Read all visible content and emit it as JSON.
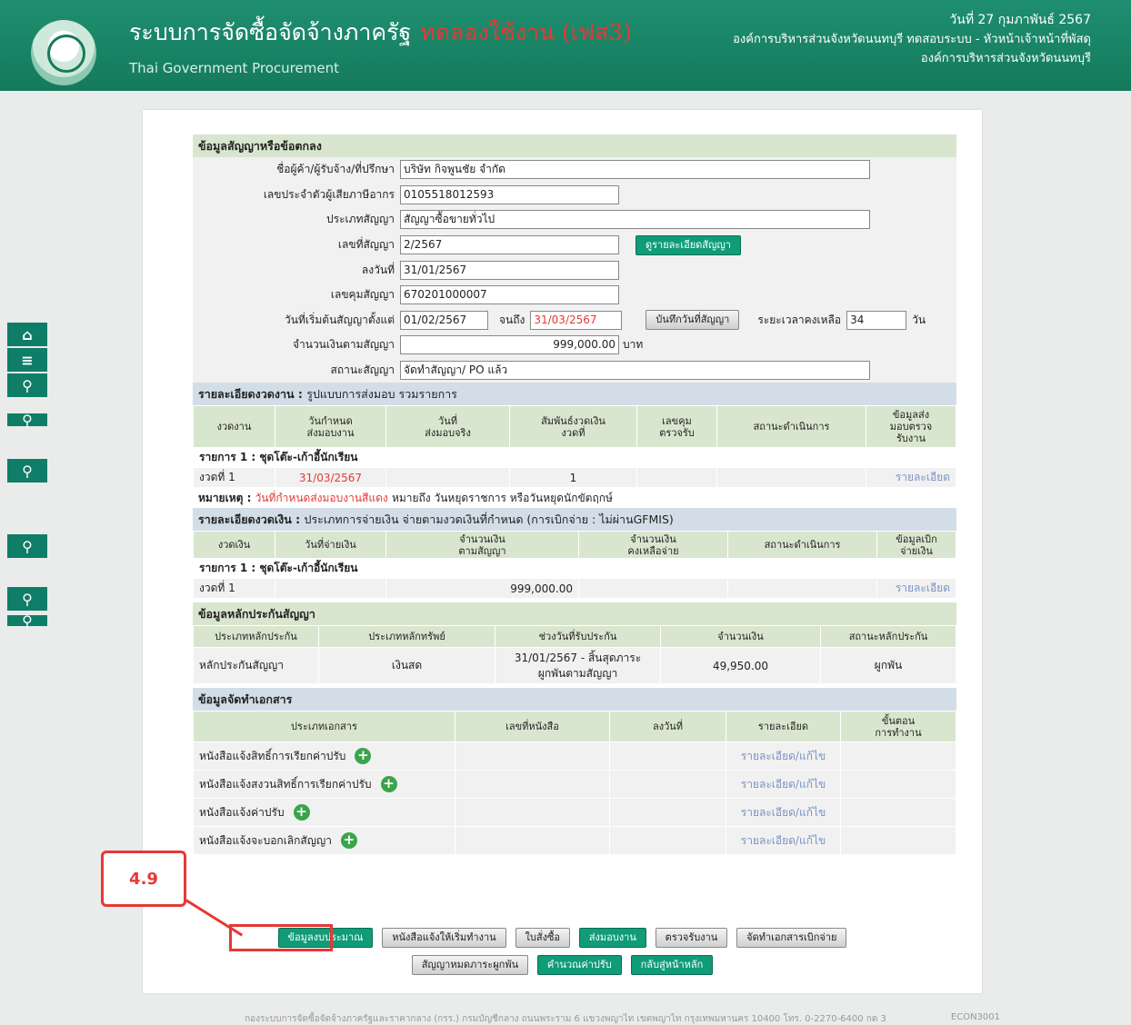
{
  "header": {
    "title": "ระบบการจัดซื้อจัดจ้างภาครัฐ",
    "title_beta": "ทดลองใช้งาน (เฟส3)",
    "subtitle": "Thai Government Procurement",
    "date": "วันที่ 27 กุมภาพันธ์ 2567",
    "user": "องค์การบริหารส่วนจังหวัดนนทบุรี ทดสอบระบบ - หัวหน้าเจ้าหน้าที่พัสดุ",
    "org": "องค์การบริหารส่วนจังหวัดนนทบุรี"
  },
  "side_icons": [
    "home-icon",
    "menu-icon",
    "search-icon",
    "search-icon",
    "search-icon",
    "search-icon",
    "search-icon",
    "search-icon"
  ],
  "contract": {
    "section_title": "ข้อมูลสัญญาหรือข้อตกลง",
    "vendor_label": "ชื่อผู้ค้า/ผู้รับจ้าง/ที่ปรึกษา",
    "vendor_value": "บริษัท กิจพูนชัย จำกัด",
    "tax_label": "เลขประจำตัวผู้เสียภาษีอากร",
    "tax_value": "0105518012593",
    "type_label": "ประเภทสัญญา",
    "type_value": "สัญญาซื้อขายทั่วไป",
    "no_label": "เลขที่สัญญา",
    "no_value": "2/2567",
    "detail_btn": "ดูรายละเอียดสัญญา",
    "signed_label": "ลงวันที่",
    "signed_value": "31/01/2567",
    "control_label": "เลขคุมสัญญา",
    "control_value": "670201000007",
    "start_label": "วันที่เริ่มต้นสัญญาตั้งแต่",
    "start_value": "01/02/2567",
    "end_label": "จนถึง",
    "end_value": "31/03/2567",
    "save_date_btn": "บันทึกวันที่สัญญา",
    "remain_label": "ระยะเวลาคงเหลือ",
    "remain_value": "34",
    "remain_unit": "วัน",
    "amount_label": "จำนวนเงินตามสัญญา",
    "amount_value": "999,000.00",
    "amount_unit": "บาท",
    "status_label": "สถานะสัญญา",
    "status_value": "จัดทำสัญญา/ PO แล้ว"
  },
  "delivery": {
    "section_title": "รายละเอียดงวดงาน :",
    "section_sub": "รูปแบบการส่งมอบ รวมรายการ",
    "headers": [
      "งวดงาน",
      "วันกำหนด\nส่งมอบงาน",
      "วันที่\nส่งมอบจริง",
      "สัมพันธ์งวดเงิน\nงวดที่",
      "เลขคุม\nตรวจรับ",
      "สถานะดำเนินการ",
      "ข้อมูลส่ง\nมอบตรวจ\nรับงาน"
    ],
    "item_title": "รายการ 1 : ชุดโต๊ะ-เก้าอี้นักเรียน",
    "row": {
      "period": "งวดที่ 1",
      "due": "31/03/2567",
      "actual": "",
      "money_period": "1",
      "control": "",
      "status": "",
      "detail": "รายละเอียด"
    },
    "note_label": "หมายเหตุ :",
    "note_red": "วันที่กำหนดส่งมอบงานสีแดง",
    "note_rest": "หมายถึง วันหยุดราชการ หรือวันหยุดนักขัตฤกษ์"
  },
  "payment": {
    "section_title": "รายละเอียดงวดเงิน :",
    "section_sub": "ประเภทการจ่ายเงิน จ่ายตามงวดเงินที่กำหนด (การเบิกจ่าย : ไม่ผ่านGFMIS)",
    "headers": [
      "งวดเงิน",
      "วันที่จ่ายเงิน",
      "จำนวนเงิน\nตามสัญญา",
      "จำนวนเงิน\nคงเหลือจ่าย",
      "สถานะดำเนินการ",
      "ข้อมูลเบิก\nจ่ายเงิน"
    ],
    "item_title": "รายการ 1 : ชุดโต๊ะ-เก้าอี้นักเรียน",
    "row": {
      "period": "งวดที่ 1",
      "paid_date": "",
      "amount": "999,000.00",
      "remain": "",
      "status": "",
      "detail": "รายละเอียด"
    }
  },
  "guarantee": {
    "section_title": "ข้อมูลหลักประกันสัญญา",
    "headers": [
      "ประเภทหลักประกัน",
      "ประเภทหลักทรัพย์",
      "ช่วงวันที่รับประกัน",
      "จำนวนเงิน",
      "สถานะหลักประกัน"
    ],
    "row": {
      "type": "หลักประกันสัญญา",
      "asset": "เงินสด",
      "period": "31/01/2567 - สิ้นสุดภาระ ผูกพันตามสัญญา",
      "amount": "49,950.00",
      "status": "ผูกพัน"
    }
  },
  "documents": {
    "section_title": "ข้อมูลจัดทำเอกสาร",
    "headers": [
      "ประเภทเอกสาร",
      "เลขที่หนังสือ",
      "ลงวันที่",
      "รายละเอียด",
      "ขั้นตอน\nการทำงาน"
    ],
    "rows": [
      {
        "name": "หนังสือแจ้งสิทธิ์การเรียกค่าปรับ",
        "detail": "รายละเอียด/แก้ไข"
      },
      {
        "name": "หนังสือแจ้งสงวนสิทธิ์การเรียกค่าปรับ",
        "detail": "รายละเอียด/แก้ไข"
      },
      {
        "name": "หนังสือแจ้งค่าปรับ",
        "detail": "รายละเอียด/แก้ไข"
      },
      {
        "name": "หนังสือแจ้งจะบอกเลิกสัญญา",
        "detail": "รายละเอียด/แก้ไข"
      }
    ]
  },
  "actions": {
    "budget": "ข้อมูลงบประมาณ",
    "start_work": "หนังสือแจ้งให้เริ่มทำงาน",
    "po": "ใบสั่งซื้อ",
    "deliver": "ส่งมอบงาน",
    "inspect": "ตรวจรับงาน",
    "disburse_doc": "จัดทำเอกสารเบิกจ่าย",
    "contract_end": "สัญญาหมดภาระผูกพัน",
    "calc_fine": "คำนวณค่าปรับ",
    "back_home": "กลับสู่หน้าหลัก"
  },
  "callout": "4.9",
  "footer": {
    "text": "กองระบบการจัดซื้อจัดจ้างภาครัฐและราคากลาง (กรร.) กรมบัญชีกลาง ถนนพระราม 6 แขวงพญาไท เขตพญาไท กรุงเทพมหานคร 10400 โทร. 0-2270-6400 กด 3",
    "code": "ECON3001"
  },
  "colors": {
    "header": "#157a5c",
    "accent_green": "#109c78",
    "alert_red": "#e53935",
    "section_green": "#d9e6cf",
    "section_blue": "#d3dde8"
  }
}
